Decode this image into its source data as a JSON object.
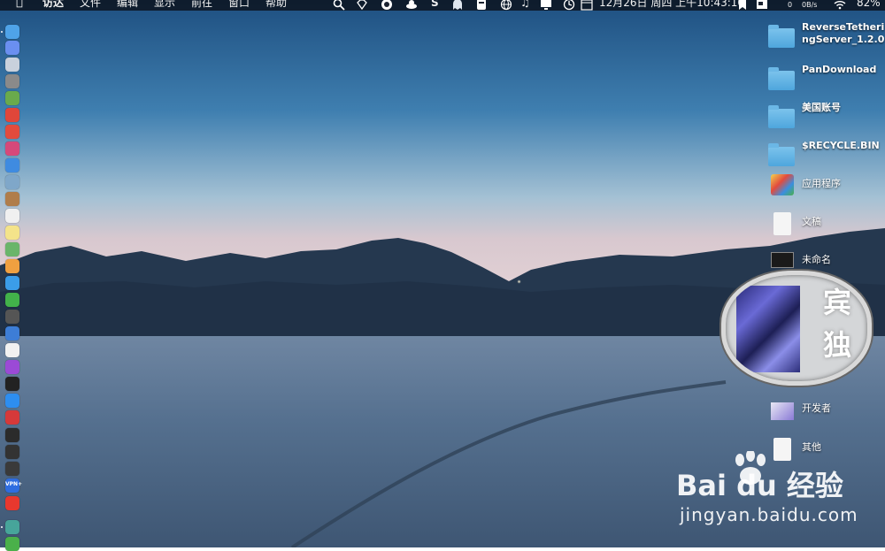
{
  "menubar": {
    "apple_icon": "apple-logo-icon",
    "items": [
      "访达",
      "文件",
      "编辑",
      "显示",
      "前往",
      "窗口",
      "帮助"
    ],
    "status": {
      "net_up": "0",
      "net_down": "0B/s",
      "datetime": "12月26日 周四 上午10:43:10",
      "battery": "82%"
    }
  },
  "dock": {
    "items": [
      {
        "name": "finder",
        "color": "#4fa3e8"
      },
      {
        "name": "siri",
        "color": "#6a8ff0"
      },
      {
        "name": "launchpad",
        "color": "#c9d1dc"
      },
      {
        "name": "rocket",
        "color": "#8a8a8a"
      },
      {
        "name": "android-studio",
        "color": "#6aaa4c"
      },
      {
        "name": "chrome",
        "color": "#e0463a"
      },
      {
        "name": "app-red",
        "color": "#e24b3d"
      },
      {
        "name": "app-pink",
        "color": "#d6497a"
      },
      {
        "name": "safari",
        "color": "#3f8be0"
      },
      {
        "name": "preview",
        "color": "#7fa7c9"
      },
      {
        "name": "notes-brown",
        "color": "#b07d4a"
      },
      {
        "name": "calendar",
        "color": "#f0f0f0"
      },
      {
        "name": "notes",
        "color": "#f4e38a"
      },
      {
        "name": "maps",
        "color": "#6ab56a"
      },
      {
        "name": "photos",
        "color": "#f0a040"
      },
      {
        "name": "messages-blue",
        "color": "#3b9de8"
      },
      {
        "name": "wechat",
        "color": "#42b24a"
      },
      {
        "name": "camera",
        "color": "#555555"
      },
      {
        "name": "keynote",
        "color": "#3d7dd6"
      },
      {
        "name": "music",
        "color": "#f1f1f1"
      },
      {
        "name": "podcasts",
        "color": "#9b4ad6"
      },
      {
        "name": "apple-tv",
        "color": "#222222"
      },
      {
        "name": "app-store",
        "color": "#2d8ef0"
      },
      {
        "name": "vivaldi",
        "color": "#d6393a"
      },
      {
        "name": "terminal",
        "color": "#2b2b2b"
      },
      {
        "name": "activity-monitor",
        "color": "#333333"
      },
      {
        "name": "console",
        "color": "#3a3a3a"
      },
      {
        "name": "vpn",
        "color": "#2f6de0"
      },
      {
        "name": "yandex",
        "color": "#e8382e"
      },
      {
        "name": "app-teal",
        "color": "#47a59a"
      },
      {
        "name": "wechat-work",
        "color": "#4ab04a"
      }
    ],
    "vpn_label": "VPN+"
  },
  "desktop": {
    "items": [
      {
        "label": "ReverseTetheringServer_1.2.0",
        "icon": "folder-icon"
      },
      {
        "label": "PanDownload",
        "icon": "folder-icon"
      },
      {
        "label": "美国账号",
        "icon": "folder-icon"
      },
      {
        "label": "$RECYCLE.BIN",
        "icon": "folder-icon"
      },
      {
        "label": "应用程序",
        "icon": "applications-icon"
      },
      {
        "label": "文稿",
        "icon": "document-icon"
      },
      {
        "label": "未命名",
        "icon": "image-file-icon"
      },
      {
        "label": "开发者",
        "icon": "developer-icon"
      },
      {
        "label": "其他",
        "icon": "other-file-icon"
      }
    ]
  },
  "magnifier": {
    "line1": "宾",
    "line2": "独"
  },
  "watermark": {
    "logo": "Bai du 经验",
    "url": "jingyan.baidu.com"
  }
}
